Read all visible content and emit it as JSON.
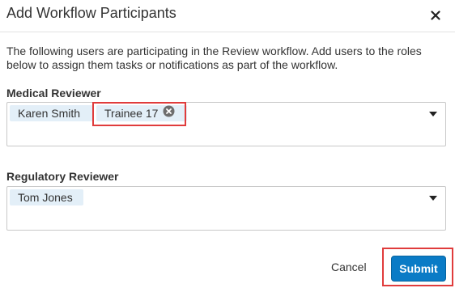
{
  "dialog": {
    "title": "Add Workflow Participants",
    "close_icon": "close-icon",
    "description": "The following users are participating in the Review workflow.  Add users to the roles below to assign them tasks or notifications as part of the workflow."
  },
  "medical_reviewer": {
    "label": "Medical Reviewer",
    "chips": [
      "Karen Smith",
      "Trainee 17"
    ],
    "remove_icon": "remove-circle-icon",
    "dropdown_icon": "caret-down-icon"
  },
  "regulatory_reviewer": {
    "label": "Regulatory Reviewer",
    "chips": [
      "Tom Jones"
    ],
    "dropdown_icon": "caret-down-icon"
  },
  "footer": {
    "cancel_label": "Cancel",
    "submit_label": "Submit"
  },
  "colors": {
    "chip_background": "#e3eff8",
    "submit_background": "#0a7bc6",
    "highlight_border": "#e03c3c",
    "input_border": "#c8c8c8"
  }
}
